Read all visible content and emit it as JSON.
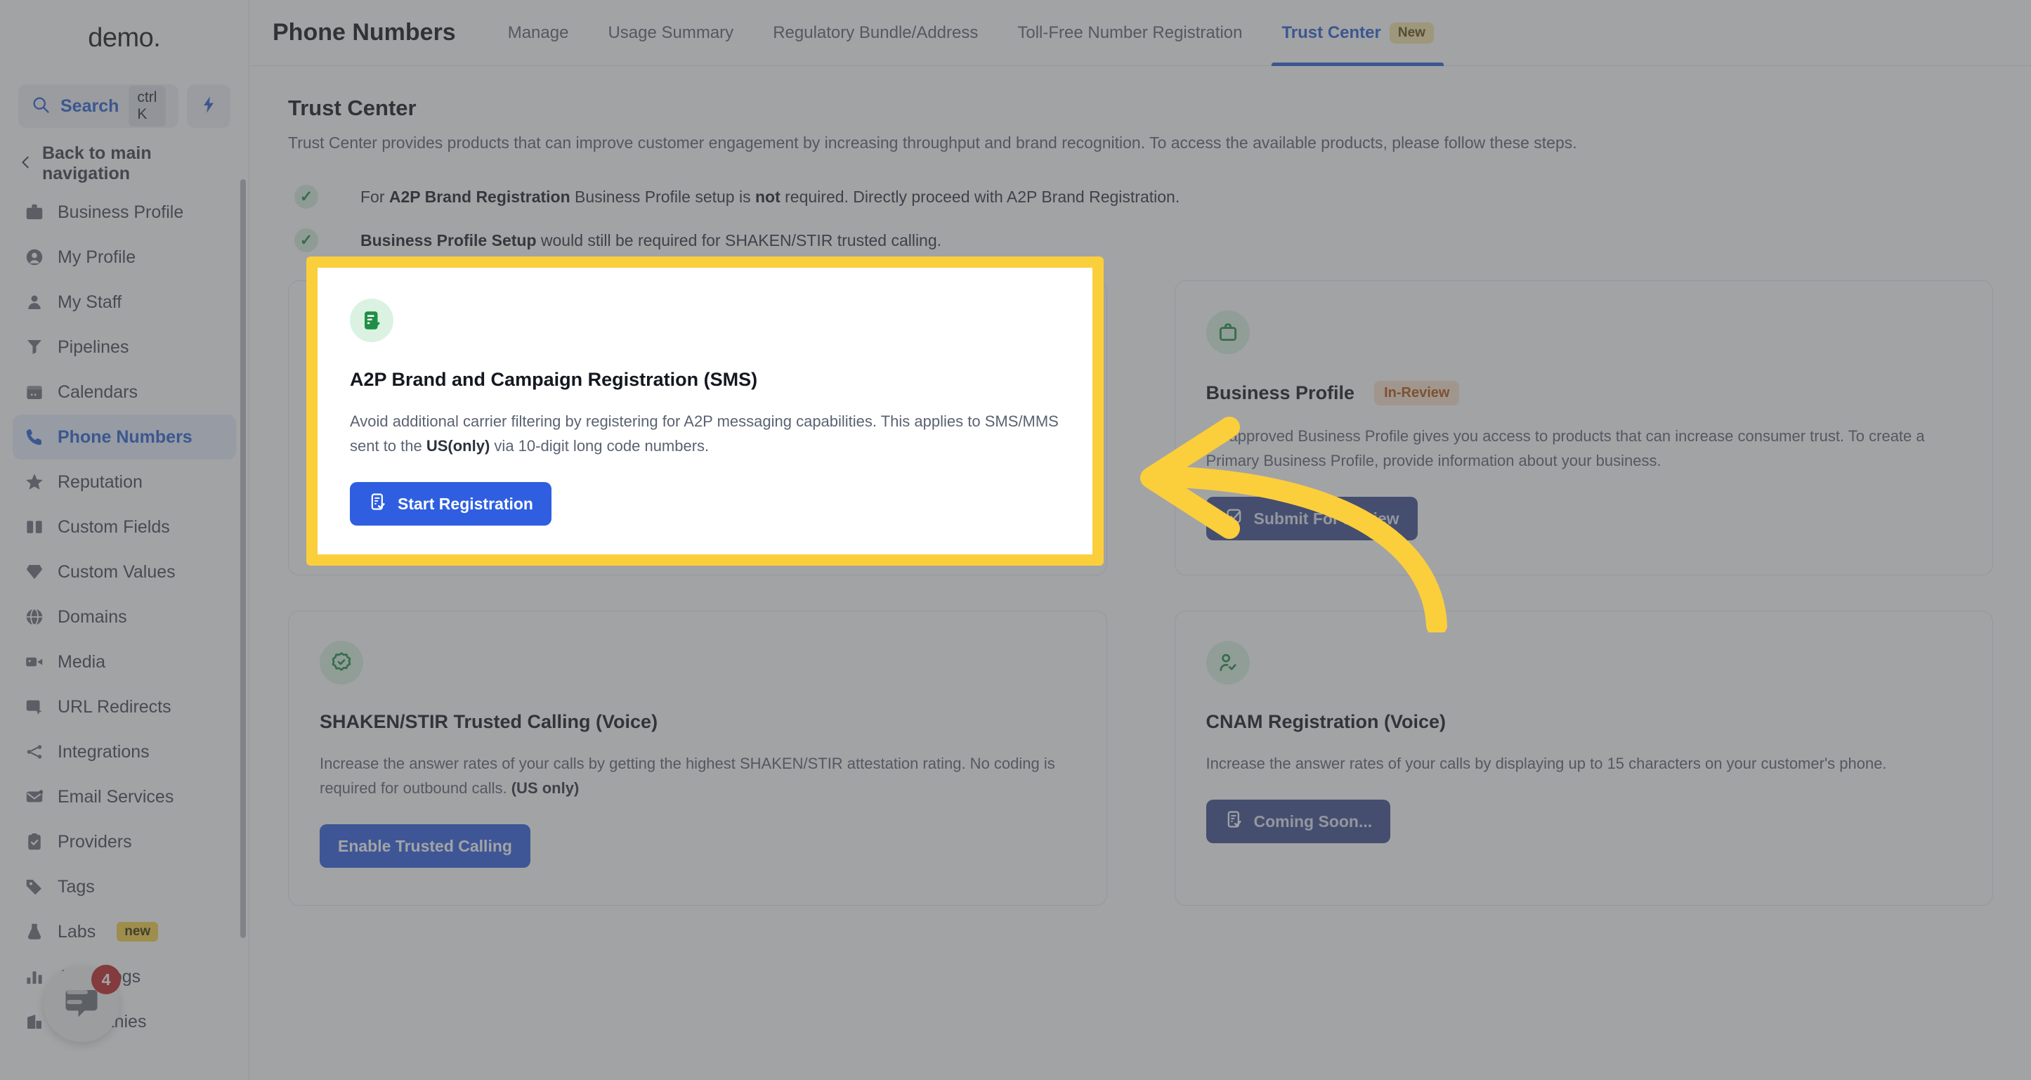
{
  "brand": {
    "name": "demo",
    "dot": "."
  },
  "sidebar": {
    "search": {
      "label": "Search",
      "shortcut": "ctrl K",
      "icon": "search-icon"
    },
    "quick_action_icon": "lightning-bolt-icon",
    "back_nav": {
      "label": "Back to main navigation",
      "icon": "chevron-left-icon"
    },
    "items": [
      {
        "label": "Business Profile",
        "icon": "briefcase-icon",
        "active": false
      },
      {
        "label": "My Profile",
        "icon": "user-circle-icon",
        "active": false
      },
      {
        "label": "My Staff",
        "icon": "user-icon",
        "active": false
      },
      {
        "label": "Pipelines",
        "icon": "funnel-icon",
        "active": false
      },
      {
        "label": "Calendars",
        "icon": "calendar-icon",
        "active": false
      },
      {
        "label": "Phone Numbers",
        "icon": "phone-icon",
        "active": true
      },
      {
        "label": "Reputation",
        "icon": "star-icon",
        "active": false
      },
      {
        "label": "Custom Fields",
        "icon": "columns-icon",
        "active": false
      },
      {
        "label": "Custom Values",
        "icon": "gem-icon",
        "active": false
      },
      {
        "label": "Domains",
        "icon": "globe-icon",
        "active": false
      },
      {
        "label": "Media",
        "icon": "video-camera-icon",
        "active": false
      },
      {
        "label": "URL Redirects",
        "icon": "cursor-window-icon",
        "active": false
      },
      {
        "label": "Integrations",
        "icon": "share-nodes-icon",
        "active": false
      },
      {
        "label": "Email Services",
        "icon": "envelope-icon",
        "active": false
      },
      {
        "label": "Providers",
        "icon": "clipboard-check-icon",
        "active": false
      },
      {
        "label": "Tags",
        "icon": "tag-icon",
        "active": false
      },
      {
        "label": "Labs",
        "icon": "flask-icon",
        "active": false,
        "badge": "new"
      },
      {
        "label": "Audit Logs",
        "icon": "bar-chart-icon",
        "active": false
      },
      {
        "label": "Companies",
        "icon": "building-icon",
        "active": false
      }
    ],
    "chat_widget": {
      "icon": "chat-bubble-icon",
      "unread_count": "4"
    }
  },
  "header": {
    "title": "Phone Numbers",
    "tabs": [
      {
        "label": "Manage",
        "active": false
      },
      {
        "label": "Usage Summary",
        "active": false
      },
      {
        "label": "Regulatory Bundle/Address",
        "active": false
      },
      {
        "label": "Toll-Free Number Registration",
        "active": false
      },
      {
        "label": "Trust Center",
        "active": true,
        "badge": "New"
      }
    ]
  },
  "main": {
    "section_title": "Trust Center",
    "section_subtitle": "Trust Center provides products that can improve customer engagement by increasing throughput and brand recognition. To access the available products, please follow these steps.",
    "checks": [
      {
        "icon": "check-icon",
        "parts": [
          {
            "text": "For ",
            "bold": false
          },
          {
            "text": "A2P Brand Registration",
            "bold": true
          },
          {
            "text": " Business Profile setup is ",
            "bold": false
          },
          {
            "text": "not",
            "bold": true
          },
          {
            "text": " required. Directly proceed with A2P Brand Registration.",
            "bold": false
          }
        ]
      },
      {
        "icon": "check-icon",
        "parts": [
          {
            "text": "Business Profile Setup",
            "bold": true
          },
          {
            "text": " would still be required for SHAKEN/STIR trusted calling.",
            "bold": false
          }
        ]
      }
    ],
    "cards": [
      {
        "id": "a2p",
        "icon": "document-check-icon",
        "title": "A2P Brand and Campaign Registration (SMS)",
        "badge": null,
        "desc_parts": [
          {
            "text": "Avoid additional carrier filtering by registering for A2P messaging capabilities. This applies to SMS/MMS sent to the ",
            "bold": false
          },
          {
            "text": "US(only)",
            "bold": true
          },
          {
            "text": " via 10-digit long code numbers.",
            "bold": false
          }
        ],
        "button": {
          "label": "Start Registration",
          "icon": "document-check-icon",
          "enabled": true
        },
        "highlighted": true
      },
      {
        "id": "business-profile",
        "icon": "briefcase-icon",
        "title": "Business Profile",
        "badge": "In-Review",
        "desc_parts": [
          {
            "text": "An approved Business Profile gives you access to products that can increase consumer trust. To create a Primary Business Profile, provide information about your business.",
            "bold": false
          }
        ],
        "button": {
          "label": "Submit For Review",
          "icon": "checkbox-icon",
          "enabled": false
        },
        "highlighted": false
      },
      {
        "id": "shaken-stir",
        "icon": "badge-check-icon",
        "title": "SHAKEN/STIR Trusted Calling (Voice)",
        "badge": null,
        "desc_parts": [
          {
            "text": "Increase the answer rates of your calls by getting the highest SHAKEN/STIR attestation rating. No coding is required for outbound calls. ",
            "bold": false
          },
          {
            "text": "(US only)",
            "bold": true
          }
        ],
        "button": {
          "label": "Enable Trusted Calling",
          "icon": null,
          "enabled": true
        },
        "highlighted": false
      },
      {
        "id": "cnam",
        "icon": "user-check-icon",
        "title": "CNAM Registration (Voice)",
        "badge": null,
        "desc_parts": [
          {
            "text": "Increase the answer rates of your calls by displaying up to 15 characters on your customer's phone.",
            "bold": false
          }
        ],
        "button": {
          "label": "Coming Soon...",
          "icon": "document-check-icon",
          "enabled": false
        },
        "highlighted": false
      }
    ]
  },
  "annotation": {
    "type": "arrow",
    "color": "#FBCE3C",
    "points_to": "a2p-card",
    "highlight_color": "#FBCE3C"
  },
  "colors": {
    "accent": "#2b61d1",
    "button": "#2f5fe0",
    "highlight": "#FBCE3C",
    "icon_bg": "#dbf2e2",
    "icon_fg": "#1f8f45",
    "status_badge_bg": "#fbe3cd",
    "status_badge_fg": "#b4540f"
  }
}
